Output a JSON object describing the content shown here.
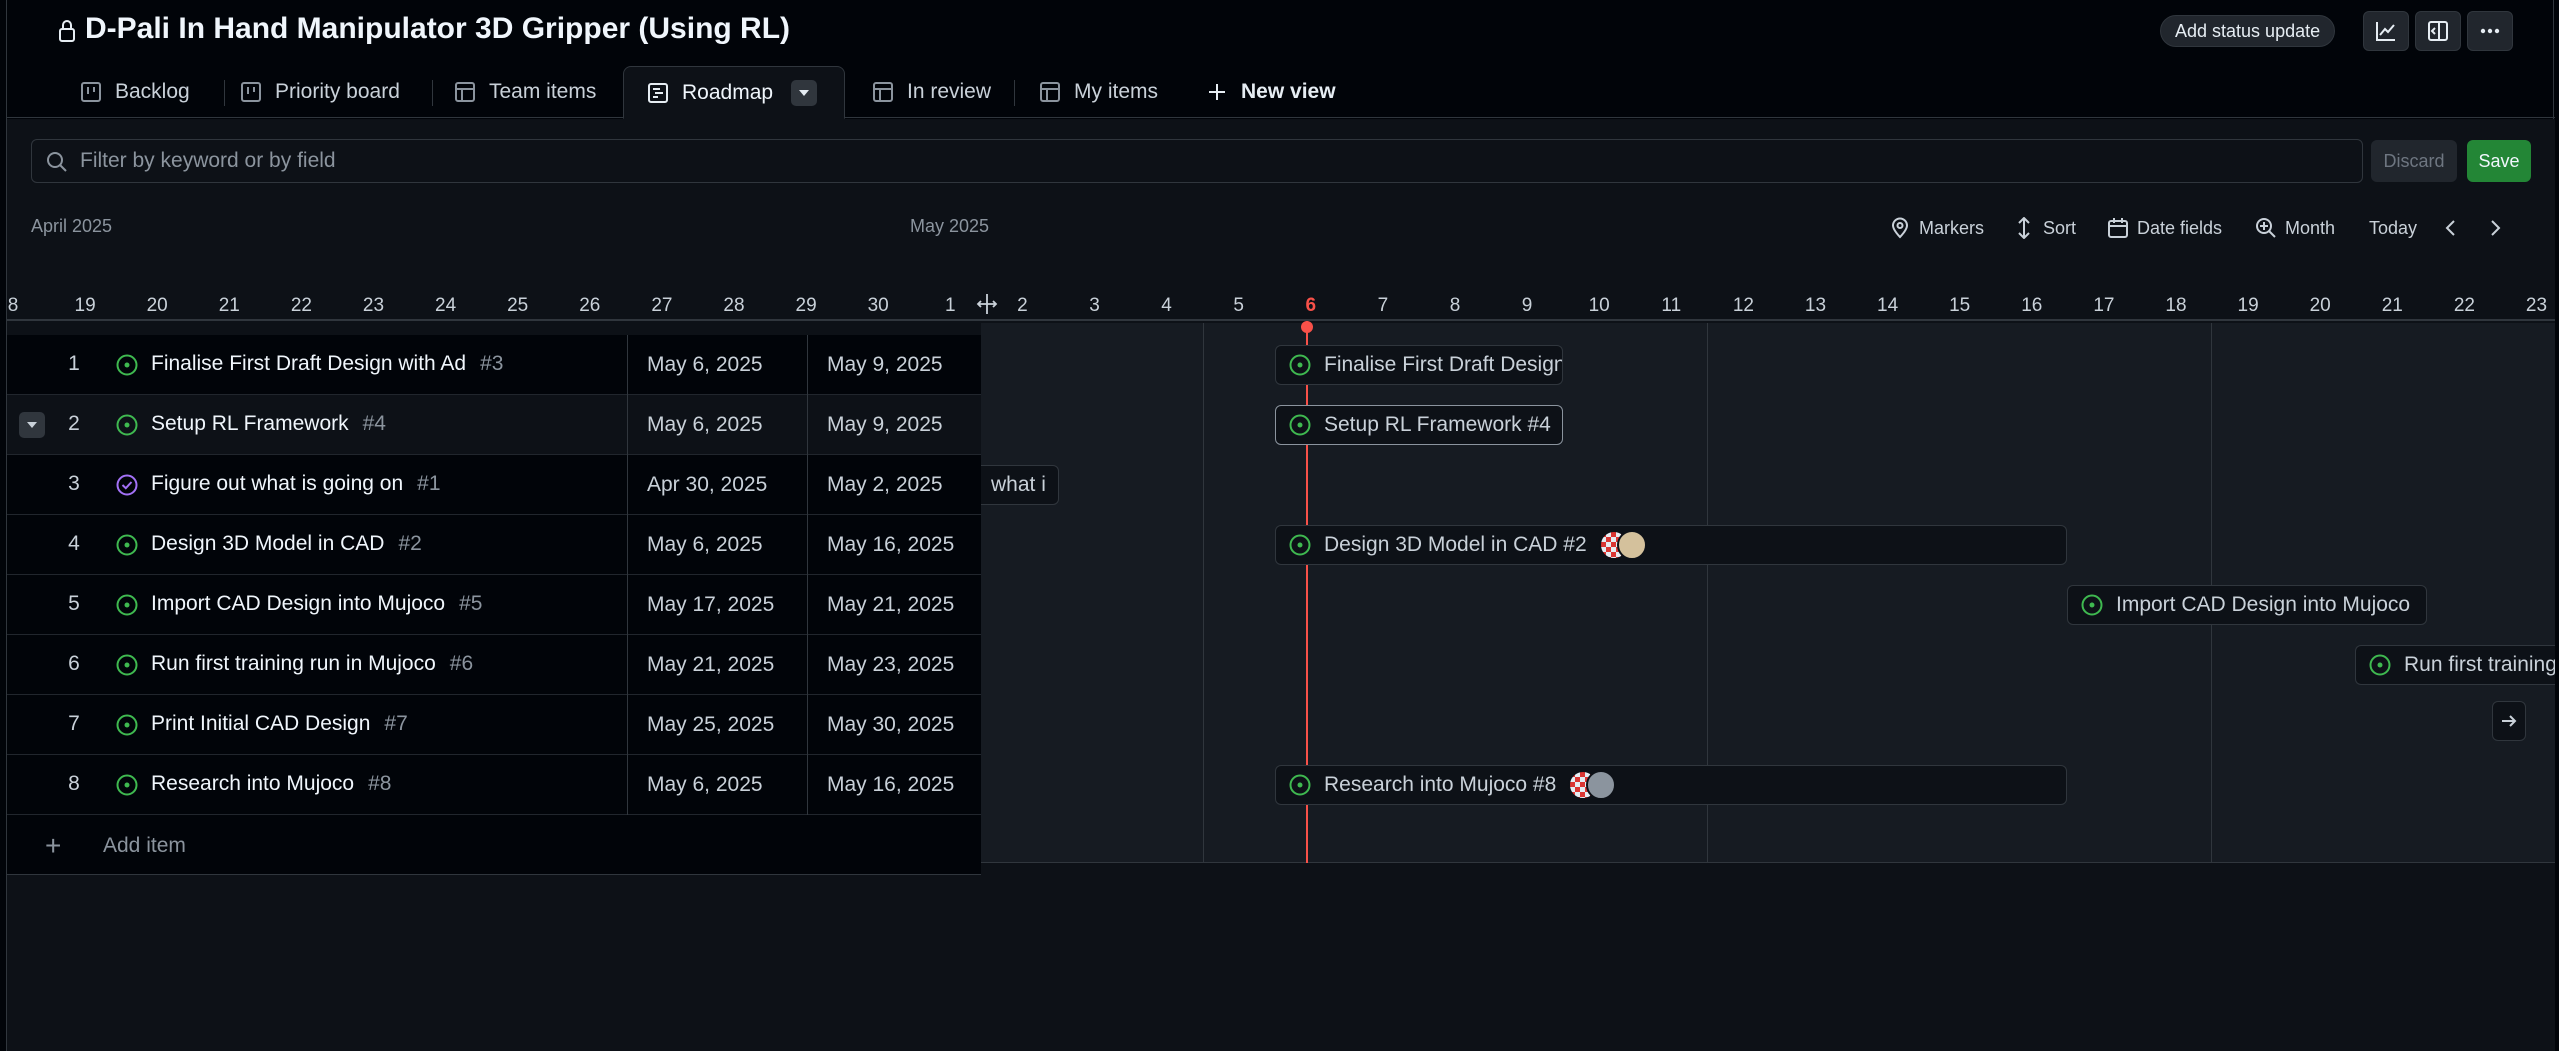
{
  "header": {
    "title": "D-Pali In Hand Manipulator 3D Gripper (Using RL)",
    "status_button": "Add status update"
  },
  "tabs": [
    {
      "label": "Backlog",
      "icon": "board-icon"
    },
    {
      "label": "Priority board",
      "icon": "board-icon"
    },
    {
      "label": "Team items",
      "icon": "table-icon"
    },
    {
      "label": "Roadmap",
      "icon": "roadmap-icon",
      "active": true
    },
    {
      "label": "In review",
      "icon": "table-icon"
    },
    {
      "label": "My items",
      "icon": "table-icon"
    },
    {
      "label": "New view",
      "icon": "plus-icon"
    }
  ],
  "filter": {
    "placeholder": "Filter by keyword or by field"
  },
  "actions": {
    "discard": "Discard",
    "save": "Save"
  },
  "timeline": {
    "month_left": "April 2025",
    "month_right": "May 2025",
    "toolbar": {
      "markers": "Markers",
      "sort": "Sort",
      "date_fields": "Date fields",
      "zoom": "Month",
      "today": "Today"
    },
    "days": [
      "8",
      "19",
      "20",
      "21",
      "22",
      "23",
      "24",
      "25",
      "26",
      "27",
      "28",
      "29",
      "30",
      "1",
      "2",
      "3",
      "4",
      "5",
      "6",
      "7",
      "8",
      "9",
      "10",
      "11",
      "12",
      "13",
      "14",
      "15",
      "16",
      "17",
      "18",
      "19",
      "20",
      "21",
      "22",
      "23"
    ],
    "today_day": "6"
  },
  "rows": [
    {
      "num": "1",
      "title": "Finalise First Draft Design with Ad",
      "ref": "#3",
      "start": "May 6, 2025",
      "end": "May 9, 2025",
      "status": "open",
      "bar_label": "Finalise First Draft Design"
    },
    {
      "num": "2",
      "title": "Setup RL Framework",
      "ref": "#4",
      "start": "May 6, 2025",
      "end": "May 9, 2025",
      "status": "open",
      "bar_label": "Setup RL Framework #4"
    },
    {
      "num": "3",
      "title": "Figure out what is going on",
      "ref": "#1",
      "start": "Apr 30, 2025",
      "end": "May 2, 2025",
      "status": "done",
      "bar_label": "what i"
    },
    {
      "num": "4",
      "title": "Design 3D Model in CAD",
      "ref": "#2",
      "start": "May 6, 2025",
      "end": "May 16, 2025",
      "status": "open",
      "bar_label": "Design 3D Model in CAD #2"
    },
    {
      "num": "5",
      "title": "Import CAD Design into Mujoco",
      "ref": "#5",
      "start": "May 17, 2025",
      "end": "May 21, 2025",
      "status": "open",
      "bar_label": "Import CAD Design into Mujoco"
    },
    {
      "num": "6",
      "title": "Run first training run in Mujoco",
      "ref": "#6",
      "start": "May 21, 2025",
      "end": "May 23, 2025",
      "status": "open",
      "bar_label": "Run first training"
    },
    {
      "num": "7",
      "title": "Print Initial CAD Design",
      "ref": "#7",
      "start": "May 25, 2025",
      "end": "May 30, 2025",
      "status": "open",
      "bar_label": ""
    },
    {
      "num": "8",
      "title": "Research into Mujoco",
      "ref": "#8",
      "start": "May 6, 2025",
      "end": "May 16, 2025",
      "status": "open",
      "bar_label": "Research into Mujoco #8"
    }
  ],
  "add_item": "Add item",
  "colors": {
    "open": "#3fb950",
    "done": "#a371f7",
    "today": "#f85149",
    "save": "#238636"
  }
}
